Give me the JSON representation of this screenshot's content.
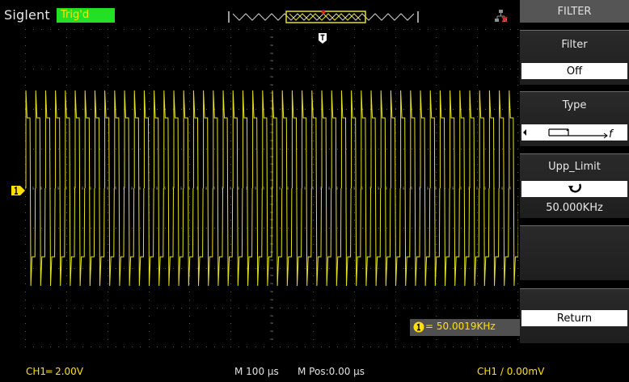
{
  "header": {
    "brand": "Siglent",
    "trigger_status": "Trig'd"
  },
  "display": {
    "waveform_color": "#e6e21a",
    "grid_color": "#5a5a5a",
    "frequency_counter": "= 50.0019KHz"
  },
  "menu": {
    "title": "FILTER",
    "filter": {
      "label": "Filter",
      "value": "Off"
    },
    "type": {
      "label": "Type",
      "value_icon": "low-pass-filter-icon"
    },
    "upp_limit": {
      "label": "Upp_Limit",
      "knob_icon": "rotate-knob-icon",
      "value": "50.000KHz"
    },
    "return": {
      "label": "Return"
    }
  },
  "status": {
    "ch1_scale": "CH1═ 2.00V",
    "timebase": "M 100 µs",
    "mpos": "M Pos:0.00 µs",
    "trigger": "CH1 ∕ 0.00mV"
  },
  "colors": {
    "accent_yellow": "#ffe000",
    "trig_green": "#22e024"
  }
}
